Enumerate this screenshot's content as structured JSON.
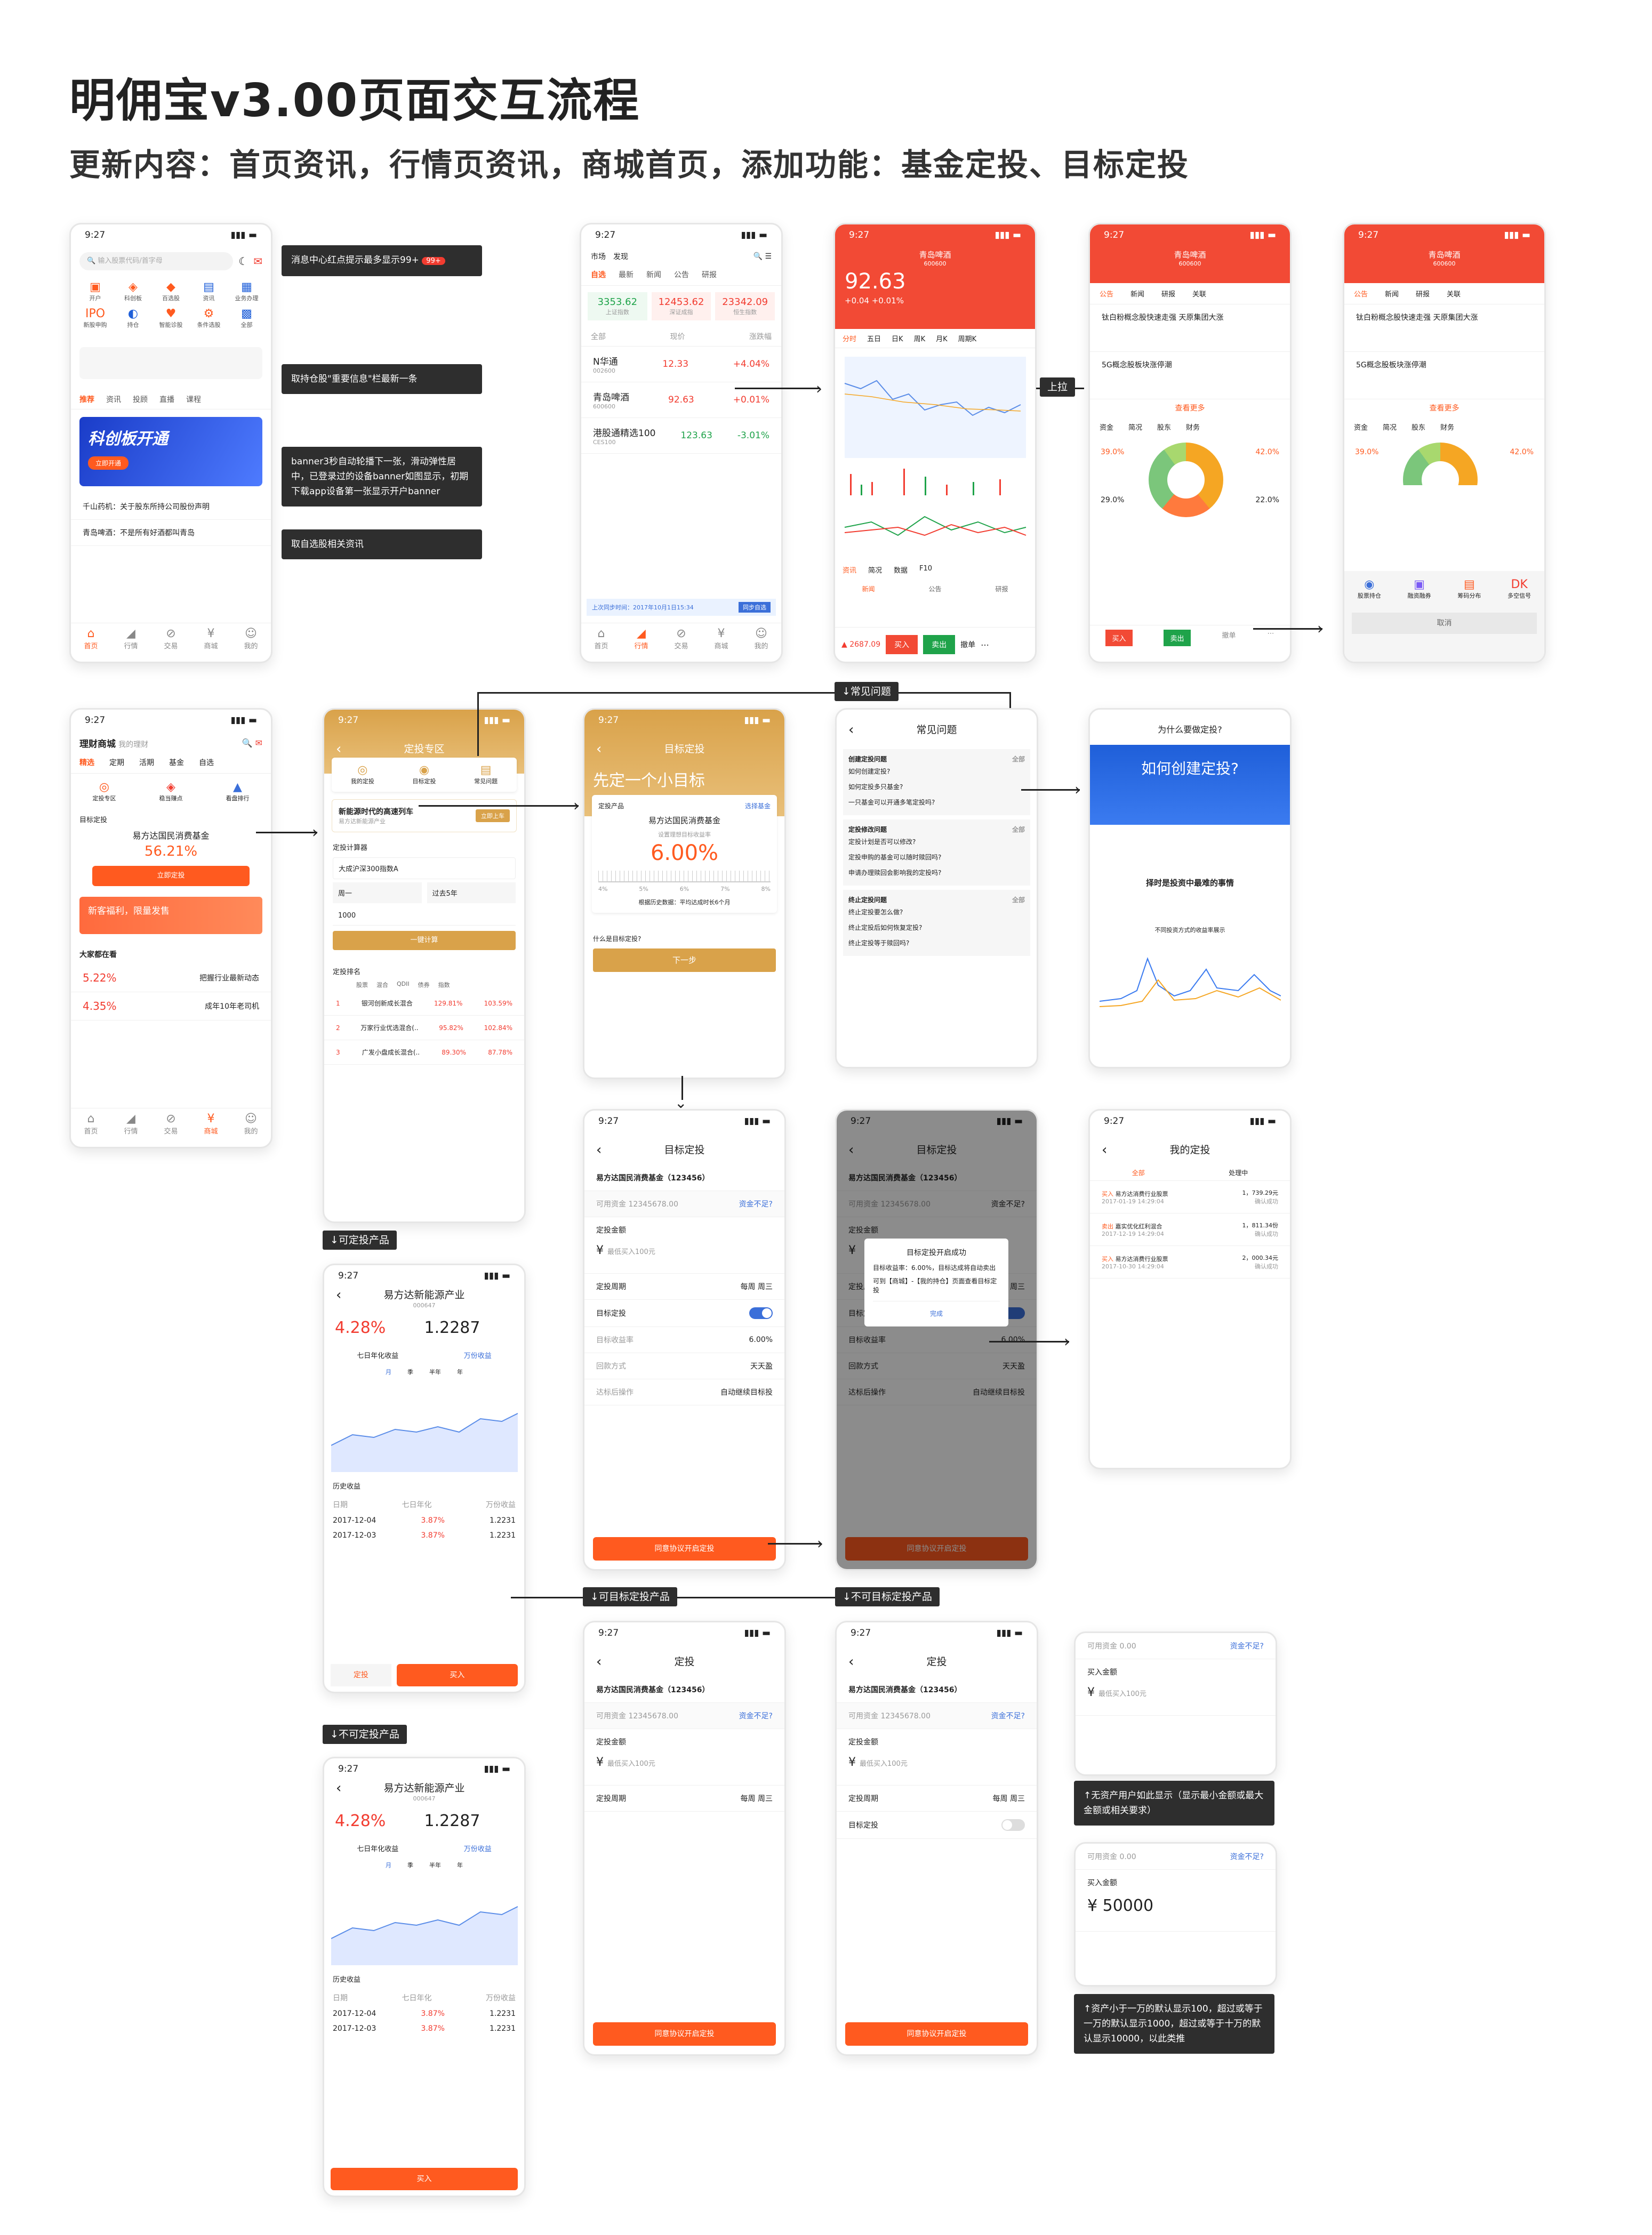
{
  "page": {
    "title": "明佣宝v3.00页面交互流程",
    "subtitle": "更新内容：首页资讯，行情页资讯，商城首页，添加功能：基金定投、目标定投"
  },
  "status_time": "9:27",
  "notes": {
    "n1": "消息中心红点提示最多显示99+",
    "n2": "取持仓股\"重要信息\"栏最新一条",
    "n3": "banner3秒自动轮播下一张，滑动弹性居中，已登录过的设备banner如图显示，初期下载app设备第一张显示开户banner",
    "n4": "取自选股相关资讯",
    "n5": "↑无资产用户如此显示（显示最小金额或最大金额或相关要求）",
    "n6": "↑资产小于一万的默认显示100，超过或等于一万的默认显示1000，超过或等于十万的默认显示10000，以此类推"
  },
  "labels": {
    "shang_la": "上拉",
    "faq": "↓常见问题",
    "can_invest": "↓可定投产品",
    "cannot_invest": "↓不可定投产品",
    "can_target": "↓可目标定投产品",
    "cannot_target": "↓不可目标定投产品"
  },
  "home": {
    "search_placeholder": "输入股票代码/首字母",
    "icons": [
      "开户",
      "科创板",
      "百选股",
      "资讯",
      "业务办理",
      "IPO",
      "新股申购",
      "持仓",
      "智能诊股",
      "条件选股",
      "全部"
    ],
    "tabs": [
      "推荐",
      "资讯",
      "投顾",
      "直播",
      "课程"
    ],
    "banner_text": "科创板开通",
    "banner_btn": "立即开通",
    "news1": "千山药机：关于股东所持公司股份声明",
    "news2": "青岛啤酒：不是所有好酒都叫青岛",
    "tabbar": [
      "首页",
      "行情",
      "交易",
      "商城",
      "我的"
    ]
  },
  "market": {
    "tabs_top": [
      "市场",
      "发现"
    ],
    "tabs": [
      "自选",
      "最新",
      "新闻",
      "公告",
      "研报"
    ],
    "indices": [
      {
        "value": "3353.62",
        "name": "上证指数"
      },
      {
        "value": "12453.62",
        "name": "深证成指"
      },
      {
        "value": "23342.09",
        "name": "恒生指数"
      }
    ],
    "cols": [
      "全部",
      "现价",
      "涨跌幅"
    ],
    "stocks": [
      {
        "name": "N华通",
        "code": "002600",
        "price": "12.33",
        "chg": "+4.04%"
      },
      {
        "name": "青岛啤酒",
        "code": "600600",
        "price": "92.63",
        "chg": "+0.01%"
      },
      {
        "name": "港股通精选100",
        "code": "CES100",
        "price": "123.63",
        "chg": "-3.01%"
      }
    ],
    "sync_time": "上次同步时间：2017年10月1日15:34",
    "sync_btn": "同步自选"
  },
  "stock": {
    "name": "青岛啤酒",
    "code": "600600",
    "price": "92.63",
    "change": "+0.04  +0.01%",
    "ktabs": [
      "分时",
      "五日",
      "日K",
      "周K",
      "月K",
      "周期K"
    ],
    "info_tabs": [
      "资讯",
      "简况",
      "数据",
      "F10"
    ],
    "sub_tabs": [
      "新闻",
      "公告",
      "研报"
    ],
    "buy": "买入",
    "sell": "卖出",
    "cancel": "撤单"
  },
  "stock_info": {
    "tabs": [
      "公告",
      "新闻",
      "研报",
      "关联"
    ],
    "headline1": "钛白粉概念股快速走强 天原集团大涨",
    "headline2": "5G概念股板块涨停潮",
    "more": "查看更多",
    "fund_tabs": [
      "资金",
      "简况",
      "股东",
      "财务"
    ],
    "pct": [
      "39.0%",
      "42.0%",
      "29.0%",
      "22.0%"
    ],
    "share_icons": [
      "股票持仓",
      "融资融券",
      "筹码分布",
      "多空信号"
    ],
    "cancel_btn": "取消"
  },
  "mall": {
    "title": "理财商城",
    "my": "我的理财",
    "tabs": [
      "精选",
      "定期",
      "活期",
      "基金",
      "自选"
    ],
    "icons": [
      "定投专区",
      "稳当赚点",
      "看盘排行"
    ],
    "target_label": "目标定投",
    "fund_name": "易方达国民消费基金",
    "fund_rate": "56.21%",
    "btn": "立即定投",
    "promo": "新客福利，限量发售",
    "list_title": "大家都在看",
    "items": [
      {
        "rate": "5.22%",
        "name": "把握行业最新动态"
      },
      {
        "rate": "4.35%",
        "name": "成年10年老司机"
      }
    ]
  },
  "dingtou_zone": {
    "title": "定投专区",
    "icons": [
      "我的定投",
      "目标定投",
      "常见问题"
    ],
    "promo": "新能源时代的高速列车",
    "promo_fund": "易方达新能源产业",
    "promo_btn": "立即上车",
    "calc_title": "定投计算器",
    "calc_fund": "大成沪深300指数A",
    "calc_cycle": "周一",
    "calc_dur": "过去5年",
    "calc_amt": "1000",
    "calc_btn": "一键计算",
    "rank_title": "定投排名",
    "rank_tabs": [
      "股票",
      "混合",
      "QDII",
      "债券",
      "指数"
    ],
    "ranks": [
      {
        "idx": "1",
        "name": "银河创新成长混合",
        "r1": "129.81%",
        "r2": "103.59%"
      },
      {
        "idx": "2",
        "name": "万家行业优选混合(..",
        "r1": "95.82%",
        "r2": "102.84%"
      },
      {
        "idx": "3",
        "name": "广发小盘成长混合(..",
        "r1": "89.30%",
        "r2": "87.78%"
      }
    ]
  },
  "target_start": {
    "nav": "目标定投",
    "headline": "先定一个小目标",
    "product_label": "定投产品",
    "choose": "选择基金",
    "fund": "易方达国民消费基金",
    "set_label": "设置理想目标收益率",
    "rate": "6.00%",
    "ticks": [
      "4%",
      "5%",
      "6%",
      "7%",
      "8%"
    ],
    "hist": "根据历史数据：平均达成时长6个月",
    "what": "什么是目标定投?",
    "next": "下一步"
  },
  "faq": {
    "nav": "常见问题",
    "sections": [
      {
        "title": "创建定投问题",
        "items": [
          "如何创建定投?",
          "如何定投多只基金?",
          "一只基金可以开通多笔定投吗?"
        ]
      },
      {
        "title": "定投修改问题",
        "items": [
          "定投计划是否可以修改?",
          "定投申购的基金可以随时赎回吗?",
          "申请办理赎回会影响我的定投吗?"
        ]
      },
      {
        "title": "终止定投问题",
        "items": [
          "终止定投要怎么做?",
          "终止定投后如何恢复定投?",
          "终止定投等于赎回吗?"
        ]
      }
    ],
    "all": "全部"
  },
  "why": {
    "nav": "为什么要做定投?",
    "banner": "如何创建定投?",
    "section": "择时是投资中最难的事情",
    "chart_title": "不同投资方式的收益率展示"
  },
  "fund_detail": {
    "name": "易方达新能源产业",
    "code": "000647",
    "rate": "4.28%",
    "nav": "1.2287",
    "tabs": [
      "七日年化收益",
      "万份收益"
    ],
    "periods": [
      "月",
      "季",
      "半年",
      "年"
    ],
    "history": "历史收益",
    "cols": [
      "日期",
      "七日年化",
      "万份收益"
    ],
    "rows": [
      [
        "2017-12-04",
        "3.87%",
        "1.2231"
      ],
      [
        "2017-12-03",
        "3.87%",
        "1.2231"
      ]
    ],
    "dingtou": "定投",
    "buy": "买入"
  },
  "target_form": {
    "nav": "目标定投",
    "fund": "易方达国民消费基金（123456）",
    "avail": "可用资金  12345678.00",
    "not_enough": "资金不足?",
    "amount_label": "定投金额",
    "placeholder": "最低买入100元",
    "cycle_label": "定投周期",
    "cycle": "每周  周三",
    "target_toggle": "目标定投",
    "target_rate_label": "目标收益率",
    "target_rate": "6.00%",
    "redeem_label": "回款方式",
    "redeem": "天天盈",
    "after_label": "达标后操作",
    "after": "自动继续目标投",
    "agree_btn": "同意协议开启定投"
  },
  "dialog": {
    "title": "目标定投开启成功",
    "body": "目标收益率：6.00%，目标达成将自动卖出",
    "hint": "可到【商城】-【我的持仓】页面查看目标定投",
    "ok": "完成"
  },
  "my_dingtou": {
    "nav": "我的定投",
    "tabs": [
      "全部",
      "处理中"
    ],
    "records": [
      {
        "tag": "买入",
        "name": "易方达消费行业股票",
        "time": "2017-01-19 14:29:04",
        "amt": "1，739.29元",
        "status": "确认成功"
      },
      {
        "tag": "卖出",
        "name": "嘉实优化红利混合",
        "time": "2017-12-19 14:29:04",
        "amt": "1，811.34份",
        "status": "确认成功"
      },
      {
        "tag": "买入",
        "name": "易方达消费行业股票",
        "time": "2017-10-30 14:29:04",
        "amt": "2，000.34元",
        "status": "确认成功"
      }
    ]
  },
  "plain_form": {
    "nav": "定投",
    "fund": "易方达国民消费基金（123456）",
    "avail": "可用资金  12345678.00",
    "amount_label": "定投金额",
    "placeholder": "最低买入100元",
    "cycle_label": "定投周期",
    "cycle": "每周  周三",
    "target_toggle": "目标定投",
    "btn": "同意协议开启定投"
  },
  "mini1": {
    "avail": "可用资金  0.00",
    "not_enough": "资金不足?",
    "label": "买入金额",
    "placeholder": "最低买入100元"
  },
  "mini2": {
    "avail": "可用资金  0.00",
    "not_enough": "资金不足?",
    "label": "买入金额",
    "value": "¥ 50000"
  },
  "colors": {
    "orange": "#ff5a1f",
    "red": "#f23c30",
    "gold": "#d9a24a",
    "blue": "#1f5fd9"
  }
}
